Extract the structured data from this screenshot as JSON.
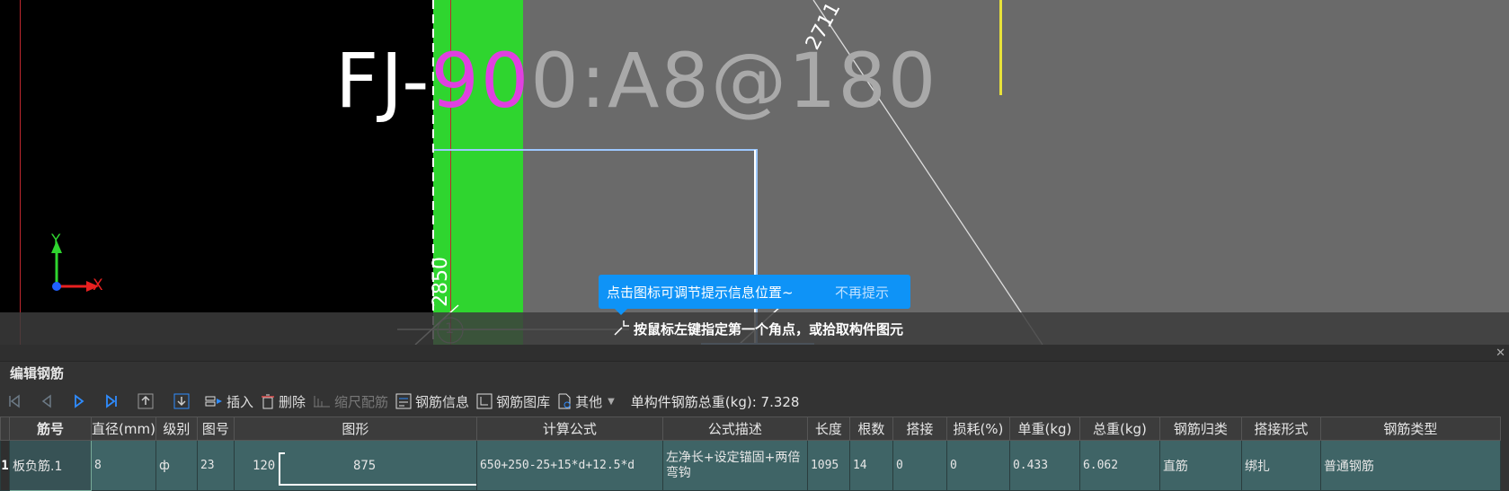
{
  "canvas": {
    "annotation": {
      "part1": "FJ-",
      "part2": "90",
      "part3": "0:A8@180"
    },
    "dimensions": {
      "diag": "2711",
      "vertical": "2850",
      "marker": "1"
    },
    "axis": {
      "y_label": "Y",
      "x_label": "X"
    },
    "status_prompt": "按鼠标左键指定第一个角点，或拾取构件图元",
    "tooltip": {
      "message": "点击图标可调节提示信息位置~",
      "dismiss": "不再提示"
    },
    "colors": {
      "canvas_bg": "#000000",
      "slab_gray": "#6a6a6a",
      "wall_green": "#2fd52f",
      "tooltip_blue": "#0e93f7",
      "row_teal": "#3f6466"
    }
  },
  "panel": {
    "title": "编辑钢筋",
    "toolbar": {
      "first_icon": "first-record-icon",
      "prev_icon": "prev-record-icon",
      "next_icon": "next-record-icon",
      "last_icon": "last-record-icon",
      "move_up_icon": "move-up-icon",
      "move_down_icon": "move-down-icon",
      "insert": "插入",
      "delete": "删除",
      "scale_rebar": "缩尺配筋",
      "rebar_info": "钢筋信息",
      "rebar_library": "钢筋图库",
      "other": "其他",
      "total_weight_label": "单构件钢筋总重(kg): 7.328"
    },
    "table": {
      "headers": [
        "筋号",
        "直径(mm)",
        "级别",
        "图号",
        "图形",
        "计算公式",
        "公式描述",
        "长度",
        "根数",
        "搭接",
        "损耗(%)",
        "单重(kg)",
        "总重(kg)",
        "钢筋归类",
        "搭接形式",
        "钢筋类型"
      ],
      "rows": [
        {
          "index": "1",
          "name": "板负筋.1",
          "diameter": "8",
          "grade": "ф",
          "shape_no": "23",
          "shape_left": "120",
          "shape_main": "875",
          "formula": "650+250-25+15*d+12.5*d",
          "description": "左净长+设定锚固+两倍弯钩",
          "length": "1095",
          "count": "14",
          "lap": "0",
          "loss": "0",
          "unit_weight": "0.433",
          "total_weight": "6.062",
          "category": "直筋",
          "lap_type": "绑扎",
          "rebar_type": "普通钢筋"
        }
      ]
    }
  }
}
